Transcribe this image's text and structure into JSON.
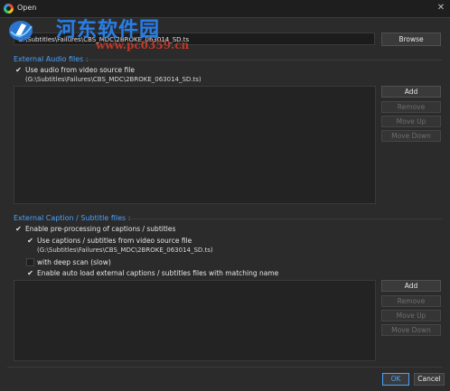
{
  "window": {
    "title": "Open",
    "close_glyph": "✕"
  },
  "watermark": {
    "title": "河东软件园",
    "url": "www.pc0359.cn",
    "icon": "hedong-logo-icon"
  },
  "file": {
    "path": "G:\\Subtitles\\Failures\\CBS_MDC\\2BROKE_063014_SD.ts",
    "browse_label": "Browse"
  },
  "audio": {
    "title": "External Audio files :",
    "use_video_label": "Use audio from video source file",
    "use_video_checked": true,
    "source_path": "(G:\\Subtitles\\Failures\\CBS_MDC\\2BROKE_063014_SD.ts)",
    "buttons": {
      "add": "Add",
      "remove": "Remove",
      "move_up": "Move Up",
      "move_down": "Move Down"
    }
  },
  "captions": {
    "title": "External Caption / Subtitle files :",
    "enable_label": "Enable pre-processing of captions / subtitles",
    "enable_checked": true,
    "use_video_label": "Use captions / subtitles from video source file",
    "use_video_checked": true,
    "source_path": "(G:\\Subtitles\\Failures\\CBS_MDC\\2BROKE_063014_SD.ts)",
    "deep_scan_label": "with deep scan (slow)",
    "deep_scan_checked": false,
    "auto_load_label": "Enable auto load external captions / subtitles files with matching name",
    "auto_load_checked": true,
    "buttons": {
      "add": "Add",
      "remove": "Remove",
      "move_up": "Move Up",
      "move_down": "Move Down"
    }
  },
  "footer": {
    "ok": "OK",
    "cancel": "Cancel"
  },
  "colors": {
    "accent": "#4aa3ff",
    "background": "#2b2b2b",
    "watermark_blue": "#2b7de0",
    "watermark_red": "#c0392b"
  }
}
